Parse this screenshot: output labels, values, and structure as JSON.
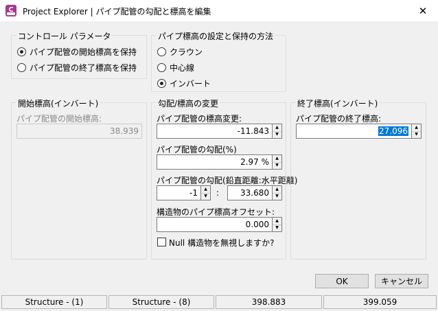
{
  "window": {
    "title": "Project Explorer | パイプ配管の勾配と標高を編集",
    "app_icon_letter": "C",
    "close_glyph": "✕"
  },
  "control_params": {
    "title": "コントロール パラメータ",
    "options": [
      {
        "label": "パイプ配管の開始標高を保持",
        "checked": true
      },
      {
        "label": "パイプ配管の終了標高を保持",
        "checked": false
      }
    ]
  },
  "pipe_elev_method": {
    "title": "パイプ標高の設定と保持の方法",
    "options": [
      {
        "label": "クラウン",
        "checked": false
      },
      {
        "label": "中心線",
        "checked": false
      },
      {
        "label": "インバート",
        "checked": true
      }
    ]
  },
  "start_elev": {
    "title": "開始標高(インバート)",
    "field_label": "パイプ配管の開始標高:",
    "value": "38.939"
  },
  "slope_elev": {
    "title": "勾配/標高の変更",
    "elev_change_label": "パイプ配管の標高変更:",
    "elev_change_value": "-11.843",
    "slope_label": "パイプ配管の勾配(%)",
    "slope_value": "2.97 %",
    "ratio_label": "パイプ配管の勾配(鉛直距離:水平距離)",
    "ratio_vertical": "-1",
    "ratio_separator": ":",
    "ratio_horizontal": "33.680",
    "offset_label": "構造物のパイプ標高オフセット:",
    "offset_value": "0.000",
    "null_checkbox_label": "Null 構造物を無視しますか?",
    "null_checked": false
  },
  "end_elev": {
    "title": "終了標高(インバート)",
    "field_label": "パイプ配管の終了標高:",
    "value": "27.096"
  },
  "buttons": {
    "ok": "OK",
    "cancel": "キャンセル"
  },
  "status_bar": [
    "Structure - (1)",
    "Structure - (8)",
    "398.883",
    "399.059"
  ],
  "colors": {
    "app_icon": "#a6378f",
    "selection": "#0078d7"
  }
}
